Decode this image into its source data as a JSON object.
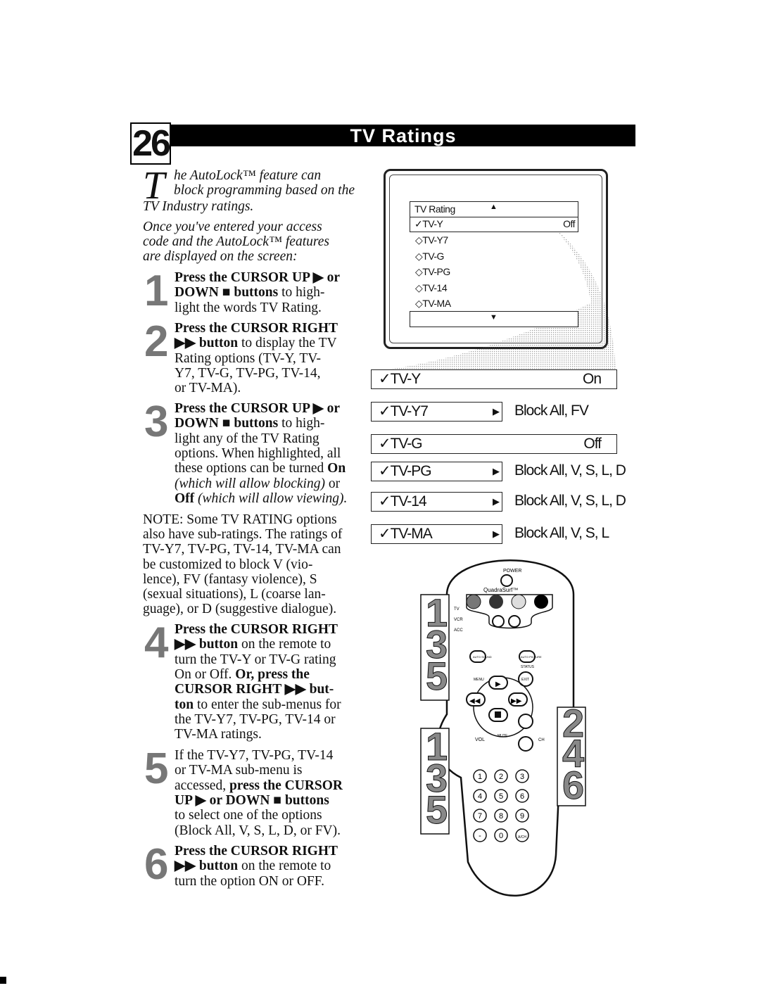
{
  "header": {
    "page_number": "26",
    "title": "TV Ratings"
  },
  "intro": {
    "drop_cap": "T",
    "lines": [
      [
        {
          "t": "he AutoLock™ feature can",
          "s": "i"
        }
      ],
      [
        {
          "t": "block programming based on the",
          "s": "i"
        }
      ],
      [
        {
          "t": "TV Industry ratings.",
          "s": "i"
        }
      ],
      [
        {
          "t": "Once you've entered your access",
          "s": "i"
        }
      ],
      [
        {
          "t": "code and the AutoLock™ features",
          "s": "i"
        }
      ],
      [
        {
          "t": "are displayed on the screen:",
          "s": "i"
        }
      ]
    ]
  },
  "steps": [
    {
      "number": "1",
      "lines": [
        [
          {
            "t": "Press the CURSOR UP ▶ or",
            "s": "b"
          }
        ],
        [
          {
            "t": "DOWN ■ buttons",
            "s": "b"
          },
          {
            "t": " to high-"
          }
        ],
        [
          {
            "t": "light the words TV Rating."
          }
        ]
      ]
    },
    {
      "number": "2",
      "lines": [
        [
          {
            "t": "Press the CURSOR RIGHT",
            "s": "b"
          }
        ],
        [
          {
            "t": "▶▶ button",
            "s": "b"
          },
          {
            "t": " to display the TV"
          }
        ],
        [
          {
            "t": "Rating options (TV-Y, TV-"
          }
        ],
        [
          {
            "t": "Y7, TV-G, TV-PG, TV-14,"
          }
        ],
        [
          {
            "t": "or TV-MA)."
          }
        ]
      ]
    },
    {
      "number": "3",
      "lines": [
        [
          {
            "t": "Press the CURSOR UP ▶ or",
            "s": "b"
          }
        ],
        [
          {
            "t": "DOWN ■ buttons",
            "s": "b"
          },
          {
            "t": " to high-"
          }
        ],
        [
          {
            "t": "light any of the TV Rating"
          }
        ],
        [
          {
            "t": "options. When highlighted, all"
          }
        ],
        [
          {
            "t": "these options can be turned "
          },
          {
            "t": "On",
            "s": "b"
          }
        ],
        [
          {
            "t": "(which will allow blocking)",
            "s": "i"
          },
          {
            "t": " or"
          }
        ],
        [
          {
            "t": "Off",
            "s": "b"
          },
          {
            "t": " (which will allow viewing).",
            "s": "i"
          }
        ]
      ]
    },
    {
      "number": "4",
      "lines": [
        [
          {
            "t": "Press the CURSOR RIGHT",
            "s": "b"
          }
        ],
        [
          {
            "t": "▶▶ button",
            "s": "b"
          },
          {
            "t": " on the remote to"
          }
        ],
        [
          {
            "t": "turn the TV-Y or TV-G rating"
          }
        ],
        [
          {
            "t": "On or Off. "
          },
          {
            "t": "Or, press the",
            "s": "b"
          }
        ],
        [
          {
            "t": "CURSOR RIGHT ▶▶ but-",
            "s": "b"
          }
        ],
        [
          {
            "t": "ton",
            "s": "b"
          },
          {
            "t": " to enter the sub-menus for"
          }
        ],
        [
          {
            "t": "the TV-Y7, TV-PG, TV-14 or"
          }
        ],
        [
          {
            "t": "TV-MA ratings."
          }
        ]
      ]
    },
    {
      "number": "5",
      "lines": [
        [
          {
            "t": "If the TV-Y7, TV-PG, TV-14"
          }
        ],
        [
          {
            "t": "or TV-MA sub-menu is"
          }
        ],
        [
          {
            "t": "accessed, "
          },
          {
            "t": "press the CURSOR",
            "s": "b"
          }
        ],
        [
          {
            "t": "UP ▶ or DOWN ■ buttons",
            "s": "b"
          }
        ],
        [
          {
            "t": "to select one of the options"
          }
        ],
        [
          {
            "t": "(Block All, V, S, L, D, or FV)."
          }
        ]
      ]
    },
    {
      "number": "6",
      "lines": [
        [
          {
            "t": "Press the CURSOR RIGHT",
            "s": "b"
          }
        ],
        [
          {
            "t": "▶▶ button",
            "s": "b"
          },
          {
            "t": " on the remote to"
          }
        ],
        [
          {
            "t": "turn the option ON or OFF."
          }
        ]
      ]
    }
  ],
  "note": {
    "lines": [
      [
        {
          "t": "NOTE: Some TV RATING options"
        }
      ],
      [
        {
          "t": "also have sub-ratings. The ratings of"
        }
      ],
      [
        {
          "t": "TV-Y7, TV-PG, TV-14, TV-MA can"
        }
      ],
      [
        {
          "t": "be customized to block V (vio-"
        }
      ],
      [
        {
          "t": "lence), FV (fantasy violence), S"
        }
      ],
      [
        {
          "t": "(sexual situations), L (coarse lan-"
        }
      ],
      [
        {
          "t": "guage), or D (suggestive dialogue)."
        }
      ]
    ]
  },
  "tv_screen": {
    "title": "TV Rating",
    "up_icon": "triangle-up",
    "down_icon": "triangle-down",
    "selected": {
      "label": "✓TV-Y",
      "value": "Off"
    },
    "options": [
      "◇TV-Y7",
      "◇TV-G",
      "◇TV-PG",
      "◇TV-14",
      "◇TV-MA"
    ]
  },
  "ratings_menu": [
    {
      "label": "✓TV-Y",
      "value": "On"
    },
    {
      "label": "✓TV-Y7",
      "arrow": "▶",
      "sub": "Block All, FV"
    },
    {
      "label": "✓TV-G",
      "value": "Off"
    },
    {
      "label": "✓TV-PG",
      "arrow": "▶",
      "sub": "Block All, V, S, L, D"
    },
    {
      "label": "✓TV-14",
      "arrow": "▶",
      "sub": "Block All, V, S, L, D"
    },
    {
      "label": "✓TV-MA",
      "arrow": "▶",
      "sub": "Block All, V, S, L"
    }
  ],
  "remote": {
    "power": "POWER",
    "quadrasurf": "QuadraSurf™",
    "modes": [
      "TV",
      "VCR",
      "ACC"
    ],
    "auto_sound": "AUTO SOUND",
    "auto_picture": "AUTO PICTURE",
    "status": "STATUS",
    "menu": "MENU",
    "exit": "EXIT",
    "mute": "MUTE",
    "vol": "VOL",
    "ch": "CH",
    "keys": [
      "1",
      "2",
      "3",
      "4",
      "5",
      "6",
      "7",
      "8",
      "9",
      "-",
      "0",
      "A/CH"
    ],
    "callouts_left": [
      "1",
      "3",
      "5"
    ],
    "callouts_left2": [
      "1",
      "3",
      "5"
    ],
    "callouts_right": [
      "2",
      "4",
      "6"
    ]
  }
}
